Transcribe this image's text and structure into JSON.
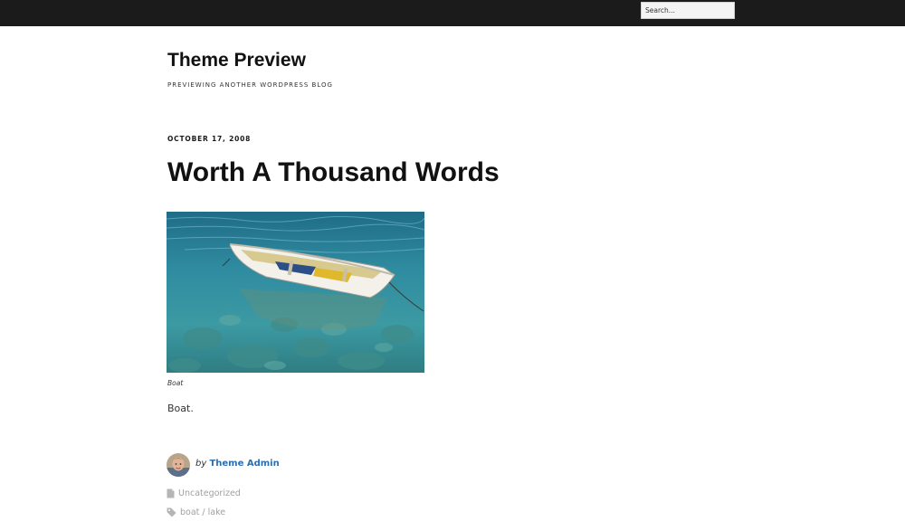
{
  "topbar": {
    "search_placeholder": "Search..."
  },
  "site": {
    "title": "Theme Preview",
    "description": "PREVIEWING ANOTHER WORDPRESS BLOG"
  },
  "post": {
    "date": "OCTOBER 17, 2008",
    "title": "Worth A Thousand Words",
    "image_caption": "Boat",
    "body": "Boat.",
    "byline_prefix": "by",
    "author": "Theme Admin",
    "category": "Uncategorized",
    "tags": [
      "boat",
      "lake"
    ],
    "tag_separator": " / "
  },
  "icons": {
    "category": "document-icon",
    "tags": "tag-icon"
  },
  "colors": {
    "topbar": "#1b1b1b",
    "author_link": "#2a6fb5",
    "meta_text": "#a0a0a0"
  }
}
